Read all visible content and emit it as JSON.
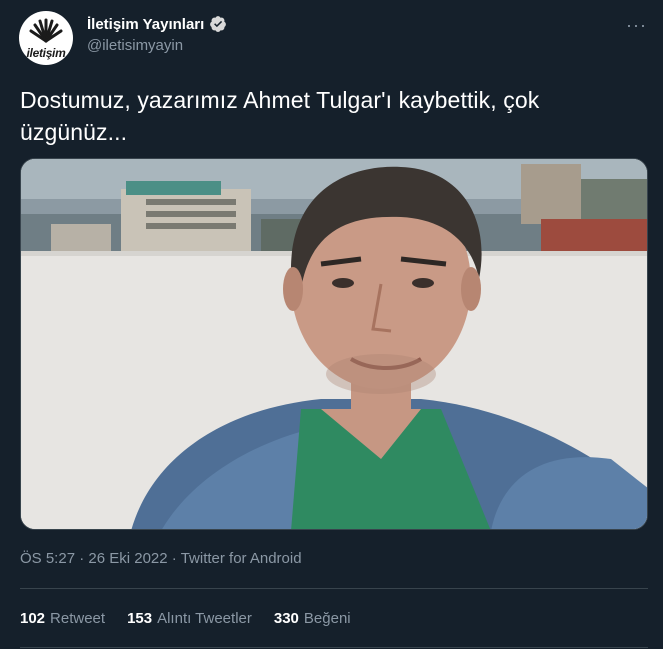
{
  "author": {
    "display_name": "İletişim Yayınları",
    "handle": "@iletisimyayin",
    "avatar_logo_text": "iletişim",
    "verified_icon": "verified-badge-icon"
  },
  "tweet": {
    "text": "Dostumuz, yazarımız Ahmet Tulgar'ı kaybettik, çok üzgünüz...",
    "more_icon": "more-options-icon"
  },
  "media": {
    "description_icon": "photo"
  },
  "meta": {
    "time": "ÖS 5:27",
    "separator_1": " · ",
    "date": "26 Eki 2022",
    "separator_2": " · ",
    "source": "Twitter for Android"
  },
  "stats": {
    "retweets_count": "102",
    "retweets_label": "Retweet",
    "quotes_count": "153",
    "quotes_label": "Alıntı Tweetler",
    "likes_count": "330",
    "likes_label": "Beğeni"
  },
  "colors": {
    "background": "#15202b",
    "text": "#ffffff",
    "secondary_text": "#8b98a5",
    "divider": "#38444d",
    "verified": "#d9d9d9"
  }
}
